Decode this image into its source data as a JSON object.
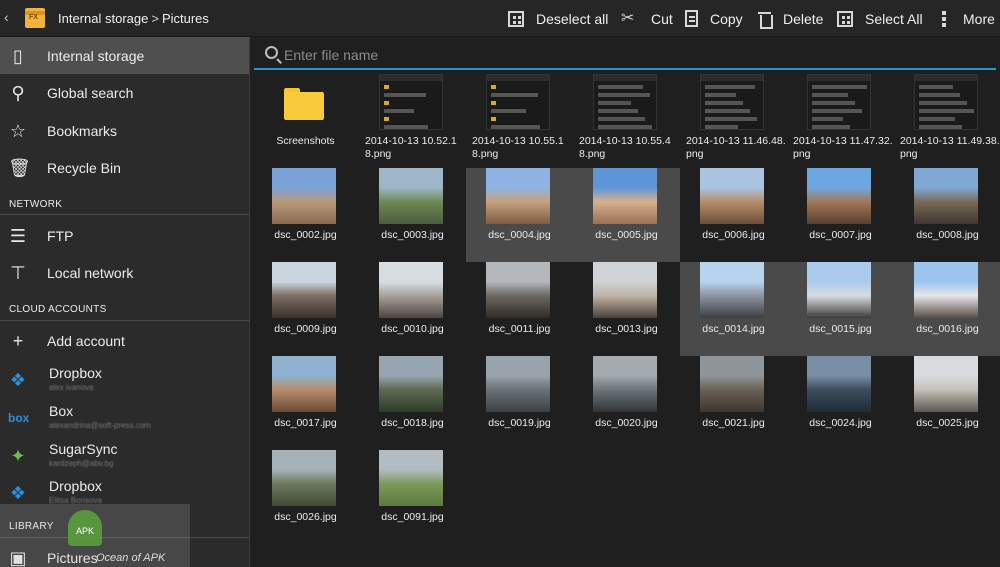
{
  "topbar": {
    "back": "‹",
    "breadcrumb": [
      "Internal storage",
      "Pictures"
    ],
    "breadcrumb_sep": ">",
    "actions": {
      "deselect_all": "Deselect all",
      "cut": "Cut",
      "copy": "Copy",
      "delete": "Delete",
      "select_all": "Select All",
      "more": "More"
    }
  },
  "sidebar": {
    "storage": [
      {
        "label": "Internal storage",
        "icon": "phone-icon"
      },
      {
        "label": "Global search",
        "icon": "search-icon"
      },
      {
        "label": "Bookmarks",
        "icon": "star-icon"
      },
      {
        "label": "Recycle Bin",
        "icon": "trash-icon"
      }
    ],
    "network_header": "NETWORK",
    "network": [
      {
        "label": "FTP",
        "icon": "server-icon"
      },
      {
        "label": "Local network",
        "icon": "network-icon"
      }
    ],
    "cloud_header": "CLOUD ACCOUNTS",
    "cloud": [
      {
        "label": "Add account",
        "icon": "plus-icon"
      },
      {
        "label": "Dropbox",
        "sub": "alex ivanova",
        "icon": "dropbox-icon"
      },
      {
        "label": "Box",
        "sub": "alexandrina@soft-press.com",
        "icon": "box-icon"
      },
      {
        "label": "SugarSync",
        "sub": "kardzeph@abv.bg",
        "icon": "sugarsync-icon"
      },
      {
        "label": "Dropbox",
        "sub": "Elitsa Borisova",
        "icon": "dropbox-icon"
      }
    ],
    "library_header": "LIBRARY",
    "library": [
      {
        "label": "Pictures",
        "icon": "image-icon"
      }
    ]
  },
  "search": {
    "placeholder": "Enter file name"
  },
  "files": [
    {
      "name": "Screenshots",
      "kind": "folder"
    },
    {
      "name": "2014-10-13 10.52.18.png",
      "kind": "screenshot"
    },
    {
      "name": "2014-10-13 10.55.18.png",
      "kind": "screenshot"
    },
    {
      "name": "2014-10-13 10.55.48.png",
      "kind": "screenshot"
    },
    {
      "name": "2014-10-13 11.46.48.png",
      "kind": "screenshot"
    },
    {
      "name": "2014-10-13 11.47.32.png",
      "kind": "screenshot"
    },
    {
      "name": "2014-10-13 11.49.38.png",
      "kind": "screenshot"
    },
    {
      "name": "dsc_0002.jpg",
      "kind": "photo",
      "selected": false
    },
    {
      "name": "dsc_0003.jpg",
      "kind": "photo",
      "selected": false
    },
    {
      "name": "dsc_0004.jpg",
      "kind": "photo",
      "selected": true
    },
    {
      "name": "dsc_0005.jpg",
      "kind": "photo",
      "selected": true
    },
    {
      "name": "dsc_0006.jpg",
      "kind": "photo",
      "selected": false
    },
    {
      "name": "dsc_0007.jpg",
      "kind": "photo",
      "selected": false
    },
    {
      "name": "dsc_0008.jpg",
      "kind": "photo",
      "selected": false
    },
    {
      "name": "dsc_0009.jpg",
      "kind": "photo",
      "selected": false
    },
    {
      "name": "dsc_0010.jpg",
      "kind": "photo",
      "selected": false
    },
    {
      "name": "dsc_0011.jpg",
      "kind": "photo",
      "selected": false
    },
    {
      "name": "dsc_0013.jpg",
      "kind": "photo",
      "selected": false
    },
    {
      "name": "dsc_0014.jpg",
      "kind": "photo",
      "selected": true
    },
    {
      "name": "dsc_0015.jpg",
      "kind": "photo",
      "selected": true
    },
    {
      "name": "dsc_0016.jpg",
      "kind": "photo",
      "selected": true
    },
    {
      "name": "dsc_0017.jpg",
      "kind": "photo",
      "selected": false
    },
    {
      "name": "dsc_0018.jpg",
      "kind": "photo",
      "selected": false
    },
    {
      "name": "dsc_0019.jpg",
      "kind": "photo",
      "selected": false
    },
    {
      "name": "dsc_0020.jpg",
      "kind": "photo",
      "selected": false
    },
    {
      "name": "dsc_0021.jpg",
      "kind": "photo",
      "selected": false
    },
    {
      "name": "dsc_0024.jpg",
      "kind": "photo",
      "selected": false
    },
    {
      "name": "dsc_0025.jpg",
      "kind": "photo",
      "selected": false
    },
    {
      "name": "dsc_0026.jpg",
      "kind": "photo",
      "selected": false
    },
    {
      "name": "dsc_0091.jpg",
      "kind": "photo",
      "selected": false
    }
  ],
  "watermark": {
    "text": "Ocean of APK",
    "badge": "APK"
  },
  "colors": {
    "accent": "#2f93c6",
    "folder": "#f7cb3a",
    "selected_bg": "#4a4a4a",
    "sidebar_active": "#4f4f4f"
  }
}
